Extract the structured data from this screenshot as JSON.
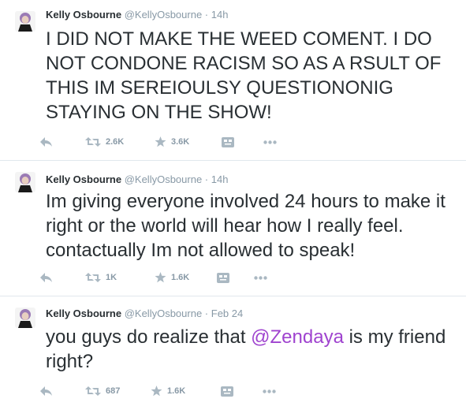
{
  "colors": {
    "text": "#292f33",
    "muted": "#8899a6",
    "icon": "#aab8c2",
    "mention": "#9f43cf",
    "divider": "#e1e8ed"
  },
  "tweets": [
    {
      "fullname": "Kelly Osbourne",
      "username": "@KellyOsbourne",
      "separator": "·",
      "time": "14h",
      "text": "I DID NOT MAKE THE WEED COMENT. I DO NOT CONDONE RACISM SO AS A RSULT OF THIS IM SEREIOULSY QUESTIONONIG STAYING ON THE SHOW!",
      "retweets": "2.6K",
      "favorites": "3.6K"
    },
    {
      "fullname": "Kelly Osbourne",
      "username": "@KellyOsbourne",
      "separator": "·",
      "time": "14h",
      "text": "Im giving everyone involved 24 hours to make it right or the world will hear how I really feel. contactually Im not allowed to speak!",
      "retweets": "1K",
      "favorites": "1.6K"
    },
    {
      "fullname": "Kelly Osbourne",
      "username": "@KellyOsbourne",
      "separator": "·",
      "time": "Feb 24",
      "text_before": "you guys do realize that ",
      "mention": "@Zendaya",
      "text_after": " is my friend right?",
      "retweets": "687",
      "favorites": "1.6K"
    }
  ]
}
